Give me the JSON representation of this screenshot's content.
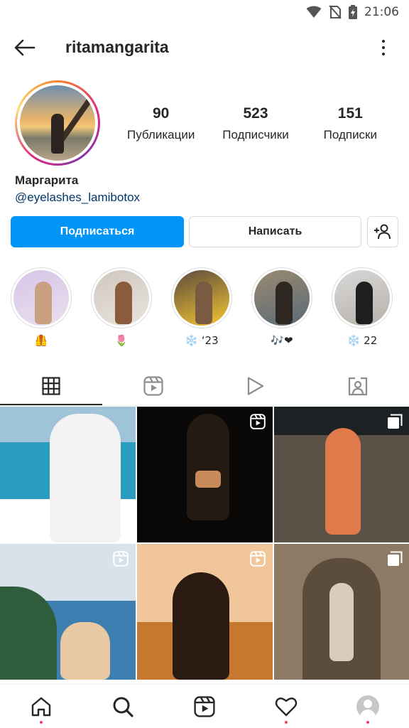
{
  "status_bar": {
    "time": "21:06",
    "icons": [
      "wifi-icon",
      "no-sim-icon",
      "battery-charging-icon"
    ]
  },
  "header": {
    "username": "ritamangarita",
    "back_icon": "arrow-left-icon",
    "more_icon": "more-vertical-icon"
  },
  "profile": {
    "stats": [
      {
        "value": "90",
        "label": "Публикации"
      },
      {
        "value": "523",
        "label": "Подписчики"
      },
      {
        "value": "151",
        "label": "Подписки"
      }
    ],
    "full_name": "Маргарита",
    "mention": "@eyelashes_lamibotox"
  },
  "actions": {
    "follow_label": "Подписаться",
    "message_label": "Написать",
    "add_icon": "add-person-icon",
    "follow_color": "#0095f6"
  },
  "highlights": [
    {
      "label": "🦺",
      "colors": [
        "#d8c4e6",
        "#e9e0ef",
        "#c9a080"
      ]
    },
    {
      "label": "🌷",
      "colors": [
        "#cfc8bf",
        "#e8e3dc",
        "#8a5b3c"
      ]
    },
    {
      "label": "❄️ ‘23",
      "colors": [
        "#5c4a3e",
        "#f4c631",
        "#7a5a40"
      ]
    },
    {
      "label": "🎶❤",
      "colors": [
        "#9a8a70",
        "#5a6a78",
        "#2e2620"
      ]
    },
    {
      "label": "❄️ 22",
      "colors": [
        "#d8d8d8",
        "#b8b0a8",
        "#1e1e1e"
      ]
    }
  ],
  "tabs": [
    {
      "name": "grid",
      "icon": "grid-icon",
      "active": true
    },
    {
      "name": "reels",
      "icon": "reels-icon",
      "active": false
    },
    {
      "name": "videos",
      "icon": "play-icon",
      "active": false
    },
    {
      "name": "tagged",
      "icon": "tagged-person-icon",
      "active": false
    }
  ],
  "posts": [
    {
      "type": "image",
      "badge": "",
      "colors": [
        "#9fc3d8",
        "#2a9cc0",
        "#f3f3f3"
      ]
    },
    {
      "type": "reel",
      "badge": "reels-icon",
      "colors": [
        "#0a0806",
        "#231a12",
        "#c98a5a"
      ]
    },
    {
      "type": "carousel",
      "badge": "carousel-icon",
      "colors": [
        "#1c2124",
        "#5b5147",
        "#e07a4a"
      ]
    },
    {
      "type": "reel",
      "badge": "reels-icon",
      "colors": [
        "#d7e2ea",
        "#3d7fb0",
        "#2f5d3c"
      ]
    },
    {
      "type": "reel",
      "badge": "reels-icon",
      "colors": [
        "#f0c69a",
        "#c7782f",
        "#2a1a12"
      ]
    },
    {
      "type": "carousel",
      "badge": "carousel-icon",
      "colors": [
        "#8c7a64",
        "#5b4c3c",
        "#d8cdbd"
      ]
    }
  ],
  "bottom_nav": [
    {
      "name": "home",
      "icon": "home-icon",
      "dot": true
    },
    {
      "name": "search",
      "icon": "search-icon",
      "dot": false
    },
    {
      "name": "reels",
      "icon": "reels-icon",
      "dot": false
    },
    {
      "name": "activity",
      "icon": "heart-icon",
      "dot": true
    },
    {
      "name": "profile",
      "icon": "profile-avatar-icon",
      "dot": true
    }
  ],
  "colors": {
    "notification_dot": "#ed4956",
    "mention_link": "#00376b",
    "text": "#262626"
  }
}
